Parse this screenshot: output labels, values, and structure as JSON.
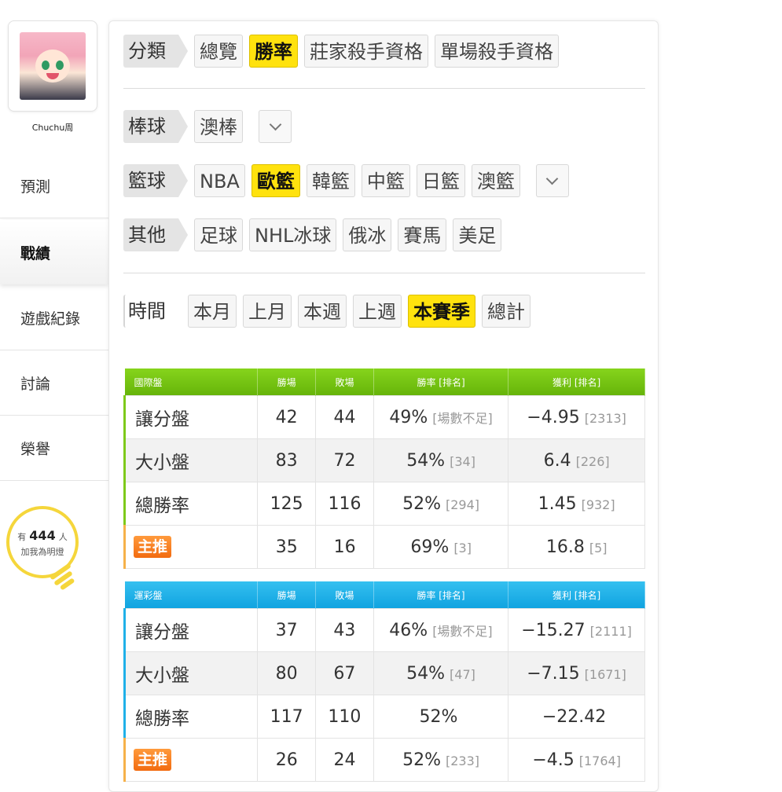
{
  "user": {
    "name": "Chuchu周"
  },
  "nav": [
    {
      "label": "預測"
    },
    {
      "label": "戰績"
    },
    {
      "label": "遊戲紀錄"
    },
    {
      "label": "討論"
    },
    {
      "label": "榮譽"
    }
  ],
  "fans": {
    "prefix": "有",
    "count": "444",
    "suffix": "人",
    "caption": "加我為明燈"
  },
  "filters": {
    "category": {
      "label": "分類",
      "items": [
        "總覽",
        "勝率",
        "莊家殺手資格",
        "單場殺手資格"
      ],
      "active": "勝率"
    },
    "baseball": {
      "label": "棒球",
      "items": [
        "澳棒"
      ]
    },
    "basketball": {
      "label": "籃球",
      "items": [
        "NBA",
        "歐籃",
        "韓籃",
        "中籃",
        "日籃",
        "澳籃"
      ],
      "active": "歐籃"
    },
    "other": {
      "label": "其他",
      "items": [
        "足球",
        "NHL冰球",
        "俄冰",
        "賽馬",
        "美足"
      ]
    },
    "time": {
      "label": "時間",
      "items": [
        "本月",
        "上月",
        "本週",
        "上週",
        "本賽季",
        "總計"
      ],
      "active": "本賽季"
    }
  },
  "columns": {
    "win": "勝場",
    "loss": "敗場",
    "rate": "勝率 [排名]",
    "profit": "獲利 [排名]"
  },
  "international": {
    "title": "國際盤",
    "rows": [
      {
        "name": "讓分盤",
        "win": "42",
        "loss": "44",
        "rate": "49%",
        "rate_rank": "[場數不足]",
        "profit": "−4.95",
        "profit_rank": "[2313]"
      },
      {
        "name": "大小盤",
        "win": "83",
        "loss": "72",
        "rate": "54%",
        "rate_rank": "[34]",
        "profit": "6.4",
        "profit_rank": "[226]"
      },
      {
        "name": "總勝率",
        "win": "125",
        "loss": "116",
        "rate": "52%",
        "rate_rank": "[294]",
        "profit": "1.45",
        "profit_rank": "[932]"
      }
    ],
    "pick": {
      "tag": "主推",
      "win": "35",
      "loss": "16",
      "rate": "69%",
      "rate_rank": "[3]",
      "profit": "16.8",
      "profit_rank": "[5]"
    }
  },
  "lottery": {
    "title": "運彩盤",
    "rows": [
      {
        "name": "讓分盤",
        "win": "37",
        "loss": "43",
        "rate": "46%",
        "rate_rank": "[場數不足]",
        "profit": "−15.27",
        "profit_rank": "[2111]"
      },
      {
        "name": "大小盤",
        "win": "80",
        "loss": "67",
        "rate": "54%",
        "rate_rank": "[47]",
        "profit": "−7.15",
        "profit_rank": "[1671]"
      },
      {
        "name": "總勝率",
        "win": "117",
        "loss": "110",
        "rate": "52%",
        "rate_rank": "",
        "profit": "−22.42",
        "profit_rank": ""
      }
    ],
    "pick": {
      "tag": "主推",
      "win": "26",
      "loss": "24",
      "rate": "52%",
      "rate_rank": "[233]",
      "profit": "−4.5",
      "profit_rank": "[1764]"
    }
  }
}
